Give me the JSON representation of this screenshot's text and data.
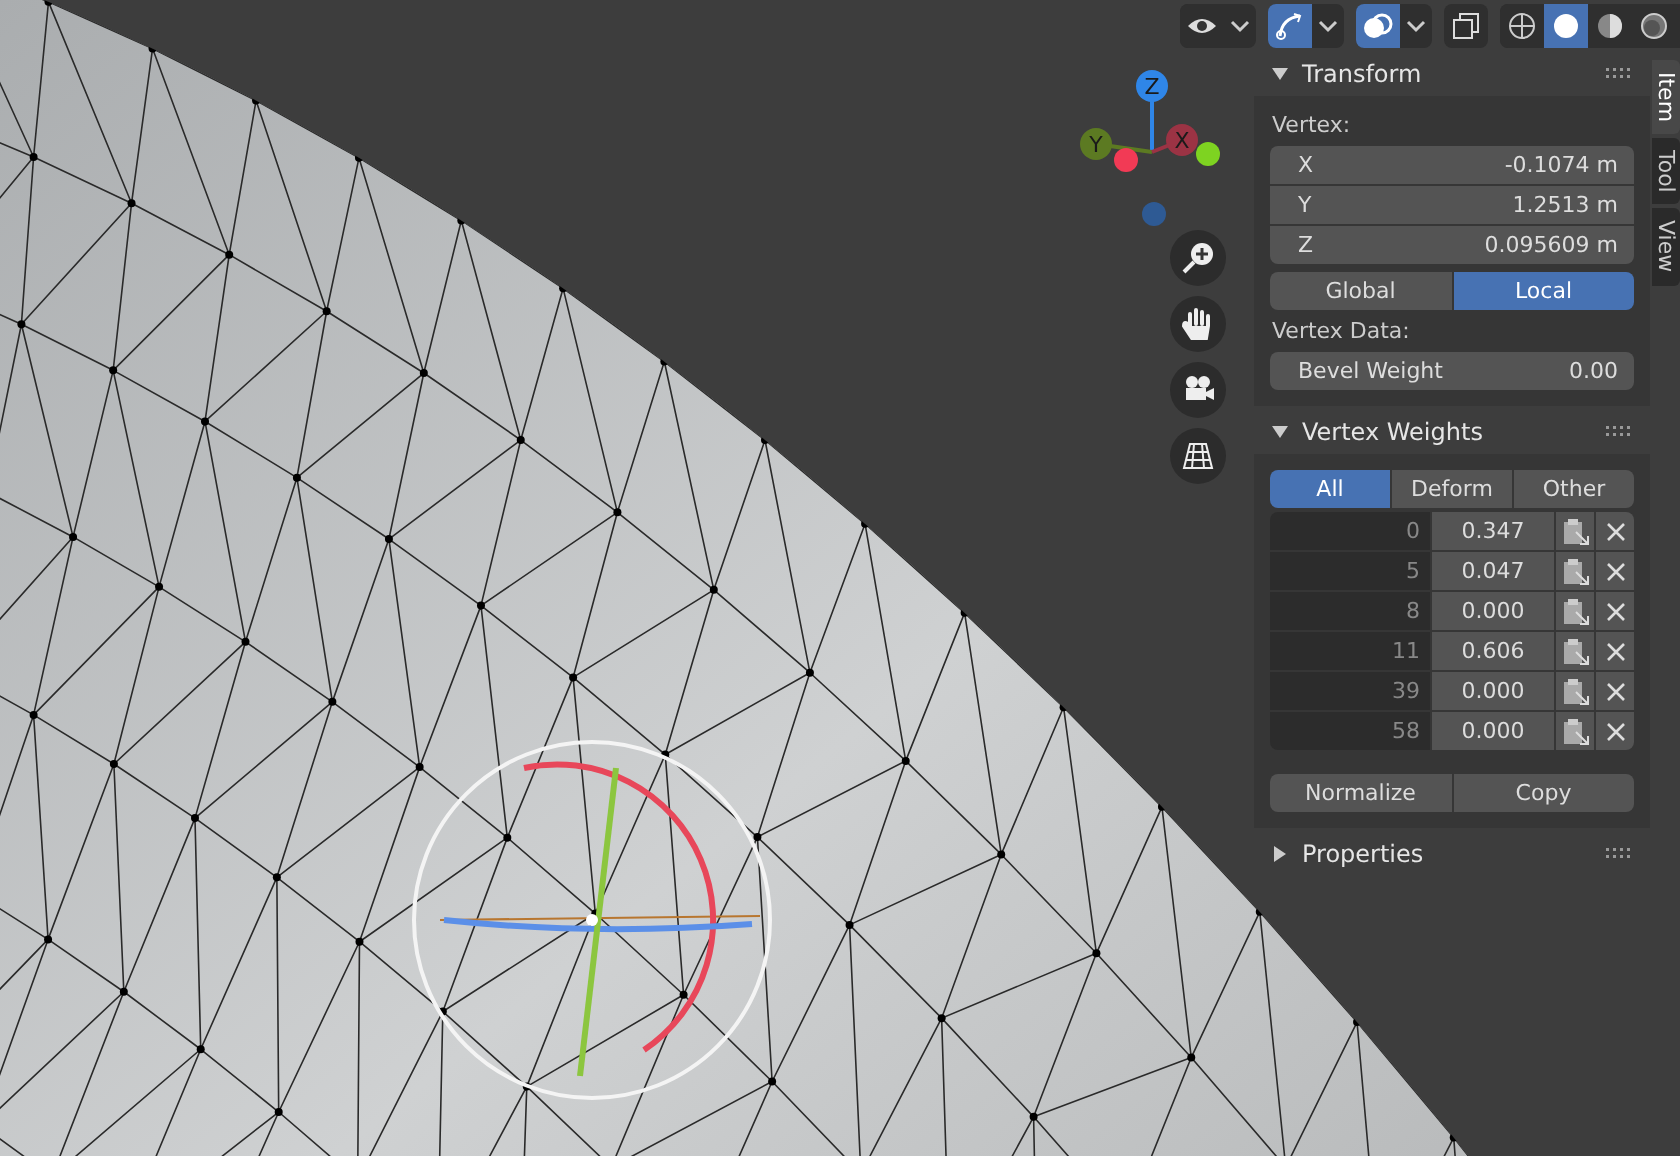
{
  "header": {
    "view_toggle": {
      "on": false
    },
    "gizmo_toggle": {
      "on": true
    },
    "overlay_toggle": {
      "on": true
    },
    "xray_toggle": {
      "on": false
    },
    "shading_modes": [
      {
        "kind": "wireframe",
        "selected": false
      },
      {
        "kind": "solid",
        "selected": true
      },
      {
        "kind": "material",
        "selected": false
      },
      {
        "kind": "rendered",
        "selected": false
      }
    ]
  },
  "gizmo": {
    "axes": [
      {
        "kind": "z",
        "label": "Z"
      },
      {
        "kind": "y",
        "label": "Y"
      },
      {
        "kind": "x",
        "label": "X"
      }
    ]
  },
  "sidebar": {
    "tabs": [
      {
        "label": "Item",
        "selected": true
      },
      {
        "label": "Tool",
        "selected": false
      },
      {
        "label": "View",
        "selected": false
      }
    ],
    "transform": {
      "title": "Transform",
      "expanded": true,
      "vertex_label": "Vertex:",
      "fields": [
        {
          "label": "X",
          "value": "-0.1074 m"
        },
        {
          "label": "Y",
          "value": "1.2513 m"
        },
        {
          "label": "Z",
          "value": "0.095609 m"
        }
      ],
      "space": [
        {
          "label": "Global",
          "selected": false
        },
        {
          "label": "Local",
          "selected": true
        }
      ],
      "vertex_data_label": "Vertex Data:",
      "bevel_weight": {
        "label": "Bevel Weight",
        "value": "0.00"
      }
    },
    "vertex_weights": {
      "title": "Vertex Weights",
      "expanded": true,
      "filters": [
        {
          "label": "All",
          "selected": true
        },
        {
          "label": "Deform",
          "selected": false
        },
        {
          "label": "Other",
          "selected": false
        }
      ],
      "rows": [
        {
          "group": "0",
          "weight": "0.347"
        },
        {
          "group": "5",
          "weight": "0.047"
        },
        {
          "group": "8",
          "weight": "0.000"
        },
        {
          "group": "11",
          "weight": "0.606"
        },
        {
          "group": "39",
          "weight": "0.000"
        },
        {
          "group": "58",
          "weight": "0.000"
        }
      ],
      "buttons": [
        "Normalize",
        "Copy"
      ]
    },
    "properties": {
      "title": "Properties",
      "expanded": false
    }
  }
}
